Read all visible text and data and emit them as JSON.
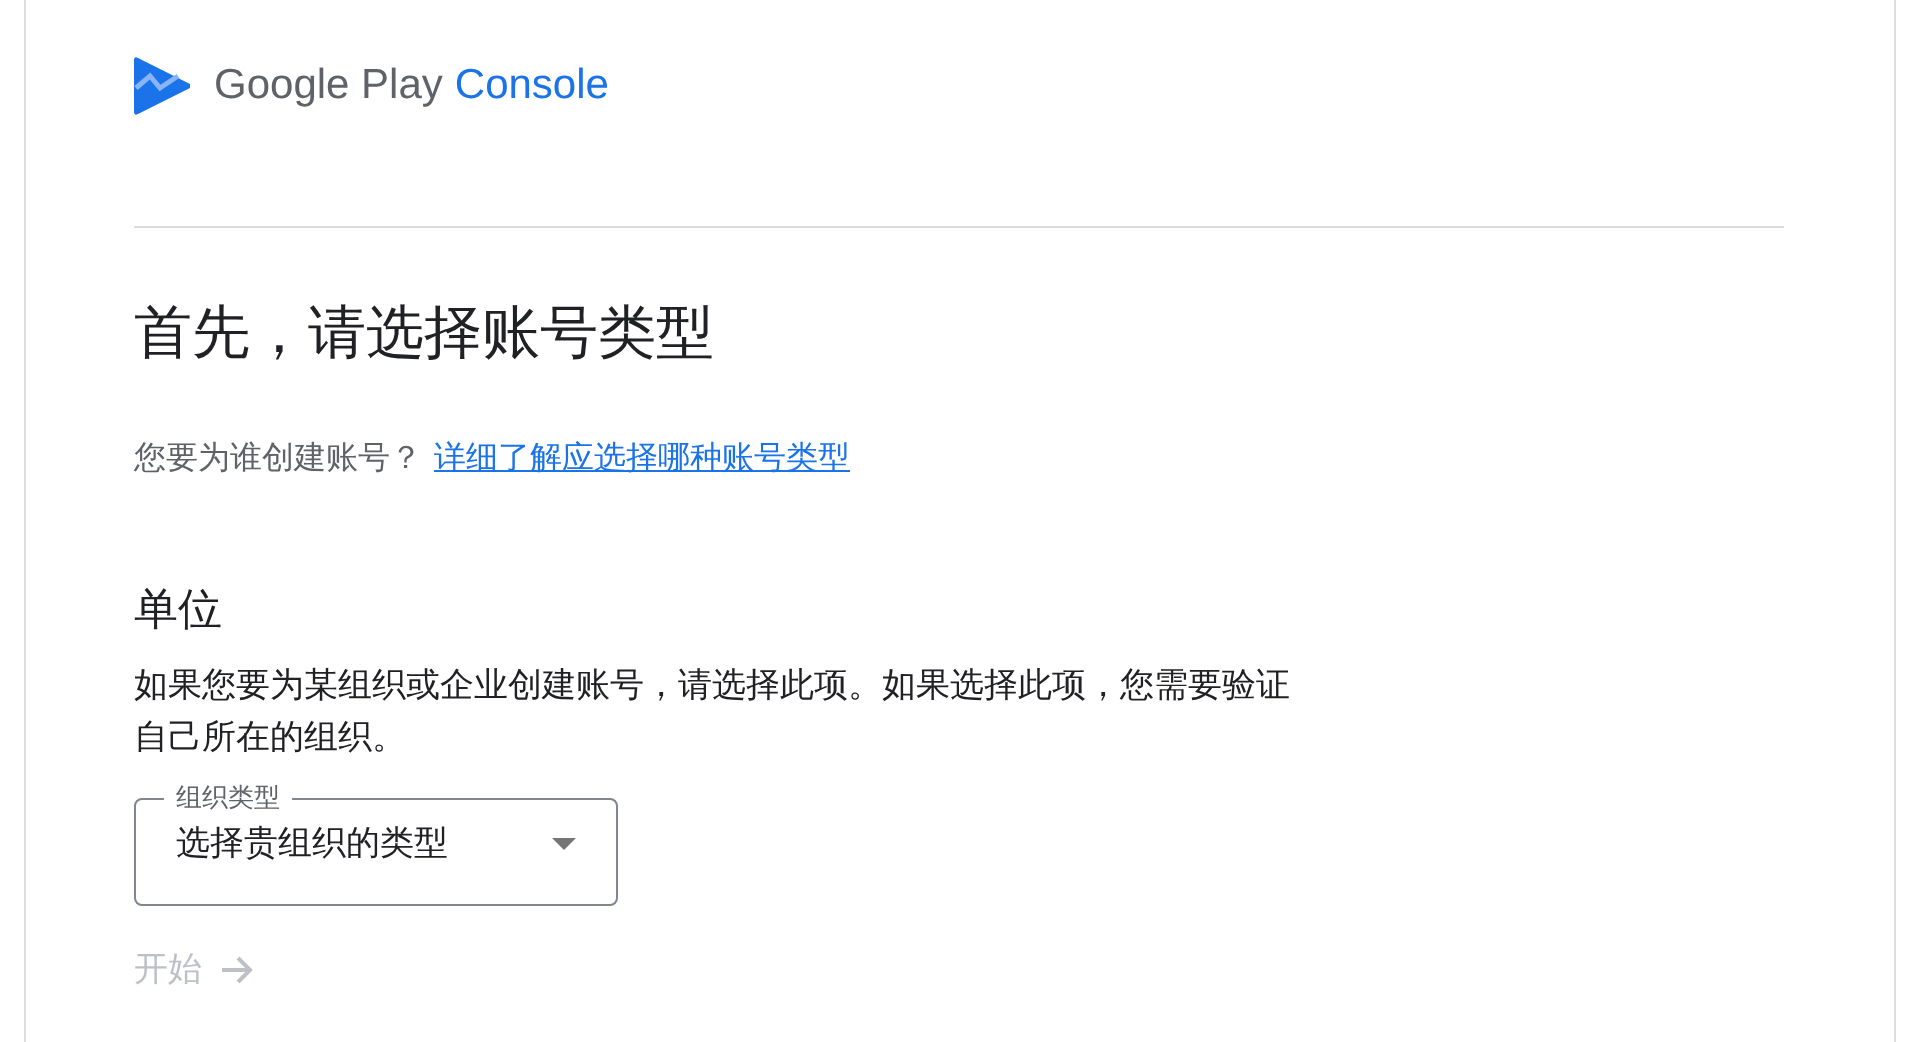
{
  "logo": {
    "brand": "Google Play",
    "product": "Console"
  },
  "heading": "首先，请选择账号类型",
  "intro": {
    "question": "您要为谁创建账号？",
    "link": "详细了解应选择哪种账号类型"
  },
  "section": {
    "title": "单位",
    "description": "如果您要为某组织或企业创建账号，请选择此项。如果选择此项，您需要验证自己所在的组织。",
    "select": {
      "label": "组织类型",
      "placeholder": "选择贵组织的类型"
    },
    "button": {
      "label": "开始",
      "disabled": true
    }
  }
}
